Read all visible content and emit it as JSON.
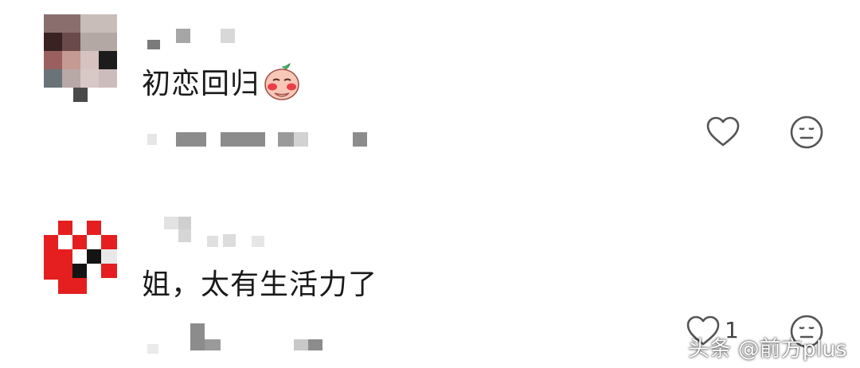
{
  "comments": [
    {
      "text": "初恋回归",
      "has_emoji": true,
      "emoji_icon": "shy-blush-emoji-icon",
      "like_icon": "heart-outline-icon",
      "reaction_icon": "neutral-face-icon",
      "like_count": ""
    },
    {
      "text": "姐，太有生活力了",
      "has_emoji": false,
      "like_icon": "heart-outline-icon",
      "reaction_icon": "neutral-face-icon",
      "like_count": "1"
    }
  ],
  "watermark": "头条 @前方plus",
  "colors": {
    "text": "#1a1a1a",
    "icon": "#555555",
    "avatar_red": "#e51f1f",
    "mosaic_gray": "#9a9a9a"
  }
}
